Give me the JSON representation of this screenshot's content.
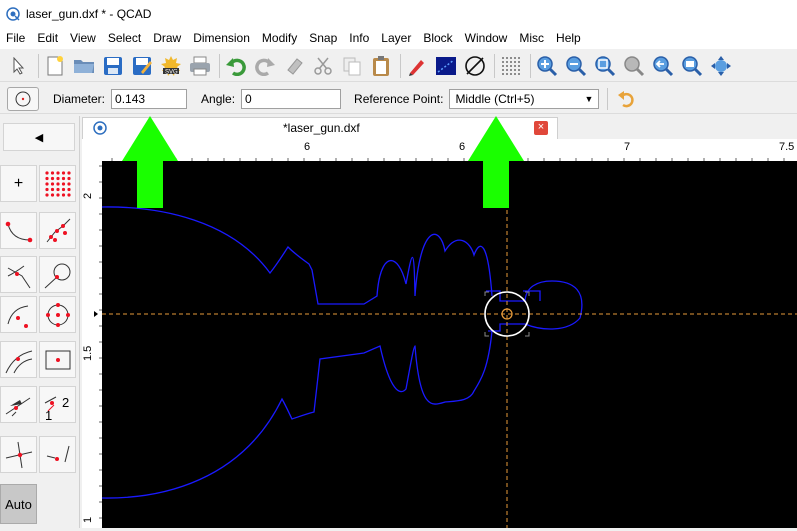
{
  "window": {
    "title": "laser_gun.dxf * - QCAD"
  },
  "menu": [
    "File",
    "Edit",
    "View",
    "Select",
    "Draw",
    "Dimension",
    "Modify",
    "Snap",
    "Info",
    "Layer",
    "Block",
    "Window",
    "Misc",
    "Help"
  ],
  "toolbar": {
    "icons": [
      "select-arrow-icon",
      "new-document-icon",
      "open-folder-icon",
      "save-icon",
      "save-as-icon",
      "svg-export-icon",
      "print-icon",
      "undo-icon",
      "redo-icon",
      "eraser-icon",
      "cut-icon",
      "copy-icon",
      "paste-icon",
      "pen-icon",
      "line-color-icon",
      "circle-tool-icon",
      "grid-icon",
      "zoom-in-icon",
      "zoom-out-icon",
      "zoom-auto-icon",
      "zoom-window-icon",
      "zoom-previous-icon",
      "zoom-selection-icon",
      "pan-icon"
    ]
  },
  "options": {
    "diameter_label": "Diameter:",
    "diameter_value": "0.143",
    "angle_label": "Angle:",
    "angle_value": "0",
    "refpoint_label": "Reference Point:",
    "refpoint_value": "Middle (Ctrl+5)"
  },
  "tools": {
    "back": "◀",
    "plus": "+",
    "auto": "Auto",
    "twelve_a": "1",
    "twelve_b": "2"
  },
  "document": {
    "tab_label": "*laser_gun.dxf"
  },
  "ruler": {
    "h_labels": [
      "6",
      "6",
      "7",
      "7.5"
    ],
    "v_labels": [
      "2",
      "1.5",
      "1"
    ]
  },
  "colors": {
    "highlight_arrow": "#1aff00",
    "crosshair": "#e69a3a",
    "drawing_line": "#1a1aff",
    "canvas_bg": "#000000"
  }
}
